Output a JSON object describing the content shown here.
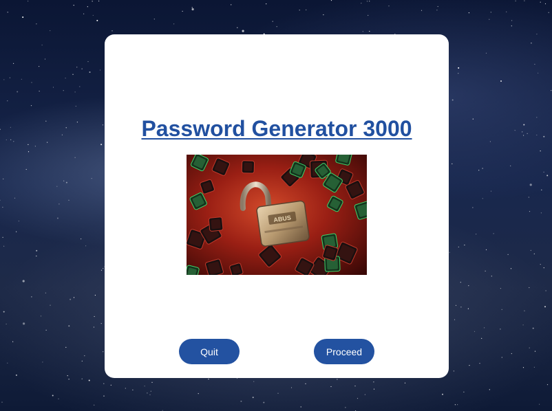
{
  "app": {
    "title": "Password Generator 3000"
  },
  "hero_image": {
    "description_icon": "padlock-on-keyboard-keys-image"
  },
  "buttons": {
    "quit_label": "Quit",
    "proceed_label": "Proceed"
  },
  "colors": {
    "accent": "#2150a0",
    "button": "#2352a1",
    "card": "#ffffff",
    "background": "#13214a"
  }
}
